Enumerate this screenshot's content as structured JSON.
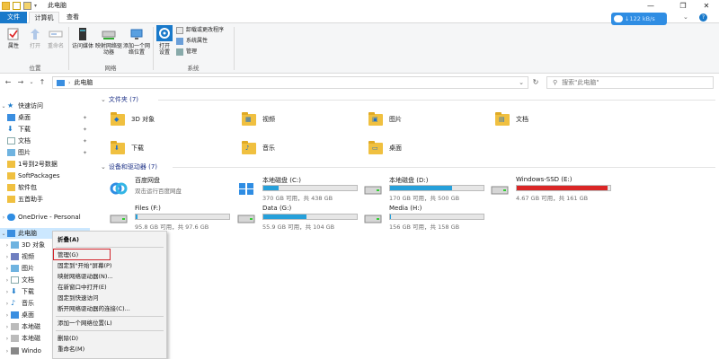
{
  "window": {
    "title": "此电脑",
    "controls": [
      "—",
      "❐",
      "✕"
    ]
  },
  "tabs": [
    "文件",
    "计算机",
    "查看"
  ],
  "ribbon": {
    "location_group": {
      "label": "位置",
      "buttons": [
        "属性",
        "打开",
        "重命名"
      ]
    },
    "network_group": {
      "label": "网络",
      "buttons": [
        "访问媒体",
        "映射网络驱动器",
        "添加一个网络位置"
      ]
    },
    "system_group": {
      "label": "系统",
      "open_settings": "打开设置",
      "items": [
        "卸载或更改程序",
        "系统属性",
        "管理"
      ]
    }
  },
  "speed_badge": "↓122 kB/s",
  "address": {
    "path": "此电脑",
    "search_placeholder": "搜索\"此电脑\""
  },
  "nav": {
    "quick_access": "快速访问",
    "pinned": [
      "桌面",
      "下载",
      "文档",
      "图片"
    ],
    "folders": [
      "1号到2号数据",
      "SoftPackages",
      "软件包",
      "五首助手"
    ],
    "onedrive": "OneDrive - Personal",
    "this_pc": "此电脑",
    "pc_children": [
      "3D 对象",
      "视频",
      "图片",
      "文档",
      "下载",
      "音乐",
      "桌面",
      "本地磁",
      "本地磁",
      "Windo"
    ]
  },
  "folders_section": {
    "title": "文件夹 (7)",
    "items": [
      "3D 对象",
      "视频",
      "图片",
      "文档",
      "下载",
      "音乐",
      "桌面"
    ]
  },
  "devices_section": {
    "title": "设备和驱动器 (7)",
    "baidu": {
      "name": "百度网盘",
      "sub": "双击运行百度网盘"
    },
    "drives": [
      {
        "name": "本地磁盘 (C:)",
        "stats": "370 GB 可用，共 438 GB",
        "used": 0.16,
        "critical": false
      },
      {
        "name": "本地磁盘 (D:)",
        "stats": "170 GB 可用，共 500 GB",
        "used": 0.66,
        "critical": false
      },
      {
        "name": "Windows-SSD (E:)",
        "stats": "4.67 GB 可用，共 161 GB",
        "used": 0.97,
        "critical": true
      },
      {
        "name": "Files (F:)",
        "stats": "95.8 GB 可用，共 97.6 GB",
        "used": 0.02,
        "critical": false
      },
      {
        "name": "Data (G:)",
        "stats": "55.9 GB 可用，共 104 GB",
        "used": 0.46,
        "critical": false
      },
      {
        "name": "Media (H:)",
        "stats": "156 GB 可用，共 158 GB",
        "used": 0.01,
        "critical": false
      }
    ]
  },
  "context_menu": {
    "items": [
      "折叠(A)",
      "管理(G)",
      "固定到\"开始\"屏幕(P)",
      "映射网络驱动器(N)...",
      "在新窗口中打开(E)",
      "固定到快速访问",
      "断开网络驱动器的连接(C)...",
      "添加一个网络位置(L)",
      "删除(D)",
      "重命名(M)"
    ]
  },
  "colors": {
    "accent": "#1979ca",
    "drive_bar": "#26a0da",
    "drive_bar_critical": "#da2626",
    "highlight_box": "#d2232a"
  }
}
